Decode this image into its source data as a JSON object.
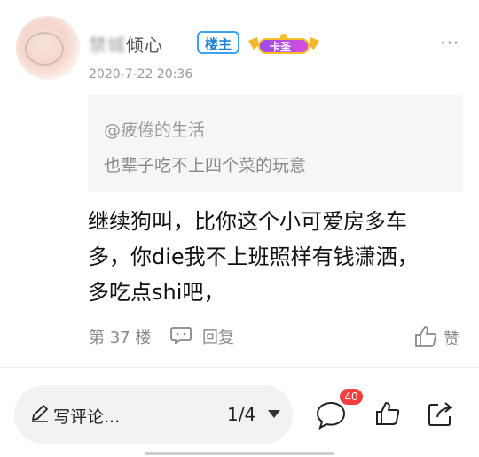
{
  "post": {
    "username_blurred": "禁城",
    "username": "倾心",
    "badge_owner": "楼主",
    "badge_rank": "卡圣",
    "date": "2020-7-22 20:36",
    "more_label": "⋯"
  },
  "quote": {
    "user": "@疲倦的生活",
    "text": "也辈子吃不上四个菜的玩意"
  },
  "content": {
    "line1": "继续狗叫，比你这个小可爱房多车",
    "line2": "多，你die我不上班照样有钱潇洒，",
    "line3": "多吃点shi吧，"
  },
  "footer": {
    "floor": "第 37 楼",
    "reply_label": "回复",
    "like_label": "赞"
  },
  "bottom_bar": {
    "write_placeholder": "写评论...",
    "page_indicator": "1/4",
    "comment_count": "40"
  },
  "icons": {
    "more": "more-icon",
    "reply": "reply-bubble-icon",
    "like": "thumbs-up-icon",
    "pen": "pen-icon",
    "comment": "comment-bubble-icon",
    "share": "share-icon"
  },
  "colors": {
    "badge_blue": "#1c7fd6",
    "notification_red": "#f33f3f",
    "quote_bg": "#f6f6f6"
  }
}
